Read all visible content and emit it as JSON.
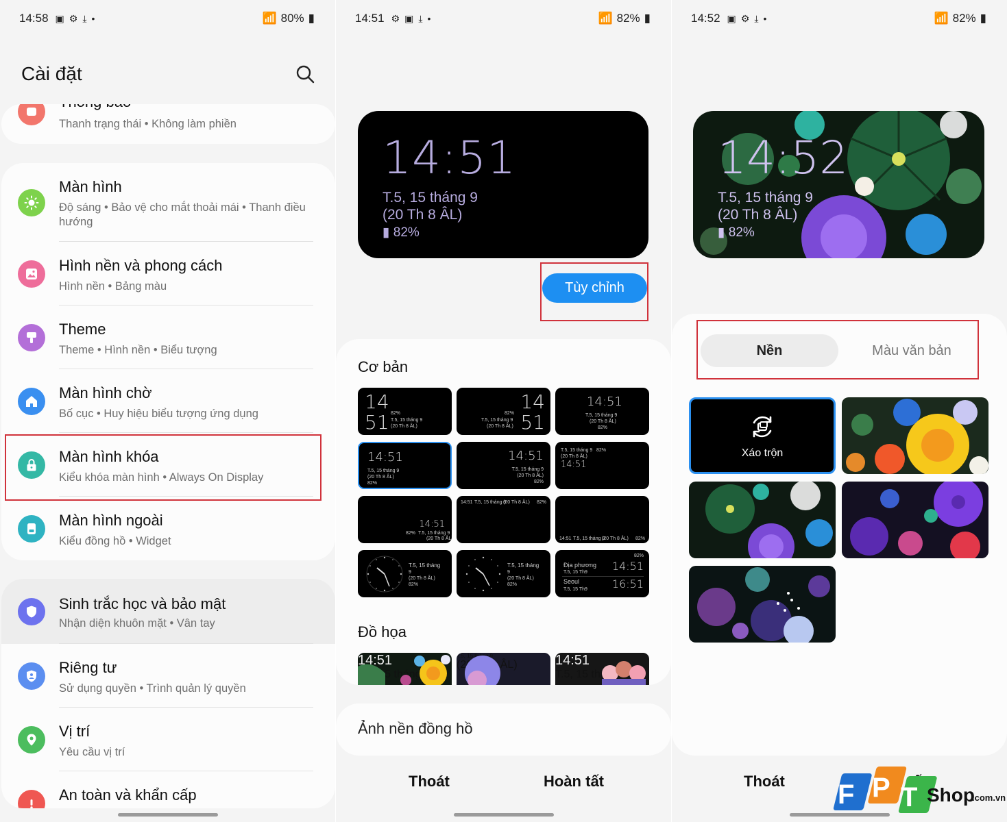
{
  "panel1": {
    "status": {
      "time": "14:58",
      "battery": "80%"
    },
    "title": "Cài đặt",
    "items": [
      {
        "title": "Thông báo",
        "subtitle": "Thanh trạng thái  •  Không làm phiền",
        "color": "#f2766c"
      },
      {
        "title": "Màn hình",
        "subtitle": "Độ sáng  •  Bảo vệ cho mắt thoải mái  •  Thanh điều hướng",
        "color": "#7ed24c"
      },
      {
        "title": "Hình nền và phong cách",
        "subtitle": "Hình nền  •  Bảng màu",
        "color": "#ee6d9a"
      },
      {
        "title": "Theme",
        "subtitle": "Theme  •  Hình nền  •  Biểu tượng",
        "color": "#b36fd8"
      },
      {
        "title": "Màn hình chờ",
        "subtitle": "Bố cục  •  Huy hiệu biểu tượng ứng dụng",
        "color": "#3a8ff0"
      },
      {
        "title": "Màn hình khóa",
        "subtitle": "Kiểu khóa màn hình  •  Always On Display",
        "color": "#34b8a5"
      },
      {
        "title": "Màn hình ngoài",
        "subtitle": "Kiểu đồng hồ  •  Widget",
        "color": "#2fb3c2"
      },
      {
        "title": "Sinh trắc học và bảo mật",
        "subtitle": "Nhận diện khuôn mặt  •  Vân tay",
        "color": "#6d72ee"
      },
      {
        "title": "Riêng tư",
        "subtitle": "Sử dụng quyền  •  Trình quản lý quyền",
        "color": "#5b8ef0"
      },
      {
        "title": "Vị trí",
        "subtitle": "Yêu cầu vị trí",
        "color": "#4cbd5e"
      },
      {
        "title": "An toàn và khẩn cấp",
        "subtitle": "",
        "color": "#ef5752"
      }
    ]
  },
  "panel2": {
    "status": {
      "time": "14:51",
      "battery": "82%"
    },
    "preview": {
      "time": "14:51",
      "date": "T.5, 15 tháng 9",
      "lunar": "(20 Th 8 ÂL)",
      "battery": "82%"
    },
    "customize_label": "Tùy chỉnh",
    "section_basic": "Cơ bản",
    "section_graphic": "Đồ họa",
    "thumb": {
      "h": "14",
      "m": "51",
      "time": "14:51",
      "batt": "82%",
      "date": "T.5, 15 tháng 9",
      "lunar": "(20 Th 8 ÂL)",
      "date_short": "T.5, 15 tháng",
      "n9": "9",
      "city1": "Địa phương",
      "city1_time": "14:51",
      "city1_sub": "T.5, 15 Th9",
      "city2": "Seoul",
      "city2_time": "16:51",
      "city2_sub": "T.5, 15 Th9"
    },
    "wallpaper_clock_label": "Ảnh nền đồng hồ",
    "exit_label": "Thoát",
    "done_label": "Hoàn tất"
  },
  "panel3": {
    "status": {
      "time": "14:52",
      "battery": "82%"
    },
    "preview": {
      "time": "14:52",
      "date": "T.5, 15 tháng 9",
      "lunar": "(20 Th 8 ÂL)",
      "battery": "82%"
    },
    "tab_background": "Nền",
    "tab_text_color": "Màu văn bản",
    "shuffle_label": "Xáo trộn",
    "exit_label": "Thoát",
    "done_label": "tất"
  },
  "logo": {
    "brand": "FPT",
    "shop": "Shop",
    "domain": ".com.vn"
  },
  "colors": {
    "accent": "#1d8ff2",
    "highlight": "#d0323b",
    "aod_text": "#b7acdf"
  }
}
